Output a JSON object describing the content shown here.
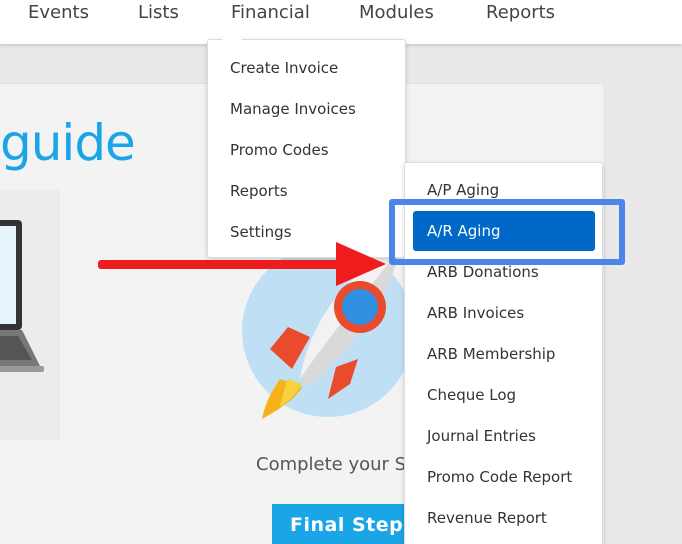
{
  "nav": {
    "items": [
      {
        "label": "Events"
      },
      {
        "label": "Lists"
      },
      {
        "label": "Financial"
      },
      {
        "label": "Modules"
      },
      {
        "label": "Reports"
      }
    ]
  },
  "financial_menu": {
    "items": [
      {
        "label": "Create Invoice"
      },
      {
        "label": "Manage Invoices"
      },
      {
        "label": "Promo Codes"
      },
      {
        "label": "Reports"
      },
      {
        "label": "Settings"
      }
    ]
  },
  "reports_menu": {
    "items": [
      {
        "label": "A/P Aging"
      },
      {
        "label": "A/R Aging",
        "active": true
      },
      {
        "label": "ARB Donations"
      },
      {
        "label": "ARB Invoices"
      },
      {
        "label": "ARB Membership"
      },
      {
        "label": "Cheque Log"
      },
      {
        "label": "Journal Entries"
      },
      {
        "label": "Promo Code Report"
      },
      {
        "label": "Revenue Report"
      }
    ]
  },
  "page": {
    "title_fragment": "guide",
    "complete_text": "Complete your Se",
    "final_button": "Final Steps"
  },
  "colors": {
    "accent": "#1aa6e6",
    "active_item": "#0069c7",
    "highlight_box": "#4a86e8",
    "arrow": "#ee1c1c"
  }
}
